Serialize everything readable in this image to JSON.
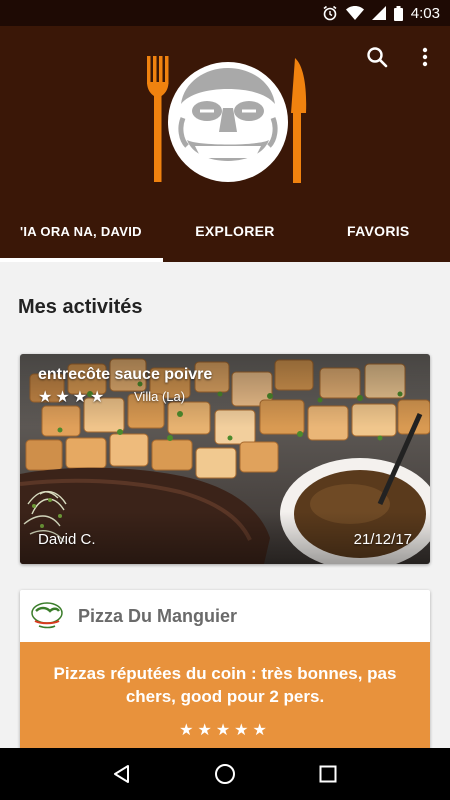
{
  "status_bar": {
    "time": "4:03",
    "icons": [
      "alarm-icon",
      "wifi-icon",
      "signal-icon",
      "battery-icon"
    ]
  },
  "header": {
    "actions": [
      "search-icon",
      "more-vert-icon"
    ],
    "colors": {
      "background": "#3a1707",
      "logo_accent": "#f0820f"
    }
  },
  "tabs": [
    {
      "label": "'IA ORA NA, DAVID",
      "active": true
    },
    {
      "label": "EXPLORER",
      "active": false
    },
    {
      "label": "FAVORIS",
      "active": false
    }
  ],
  "main": {
    "section_title": "Mes activités",
    "photo_card": {
      "title": "entrecôte sauce poivre",
      "stars": "★★★★",
      "rating": 4,
      "place": "Villa (La)",
      "author": "David C.",
      "date": "21/12/17"
    },
    "review_card": {
      "restaurant": "Pizza Du Manguier",
      "text": "Pizzas réputées du coin : très bonnes, pas chers, good pour 2 pers.",
      "stars": "★★★★★",
      "rating": 5,
      "accent_color": "#e8923c"
    }
  },
  "nav_bar": {
    "buttons": [
      "back-icon",
      "home-icon",
      "recents-icon"
    ]
  }
}
